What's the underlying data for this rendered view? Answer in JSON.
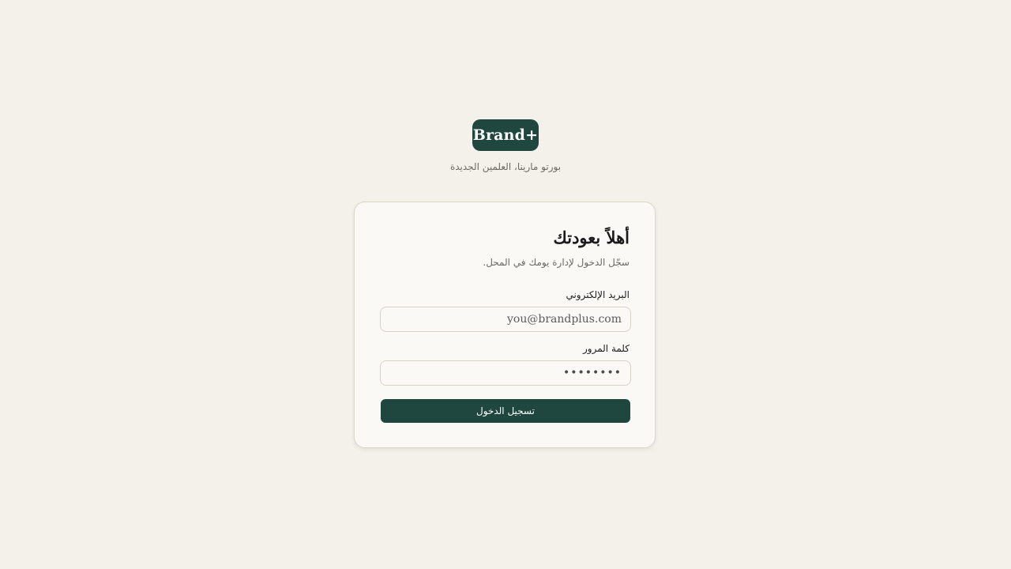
{
  "brand": {
    "logo_text": "Brand+",
    "tagline": "بورتو مارينا، العلمين الجديدة"
  },
  "login": {
    "title": "أهلاً بعودتك",
    "subtitle": "سجّل الدخول لإدارة يومك في المحل.",
    "email": {
      "label": "البريد الإلكتروني",
      "placeholder": "you@brandplus.com"
    },
    "password": {
      "label": "كلمة المرور",
      "value": "••••••••"
    },
    "submit_label": "تسجيل الدخول"
  },
  "colors": {
    "background": "#f4f1ea",
    "card": "#faf9f5",
    "accent": "#1f4740"
  }
}
